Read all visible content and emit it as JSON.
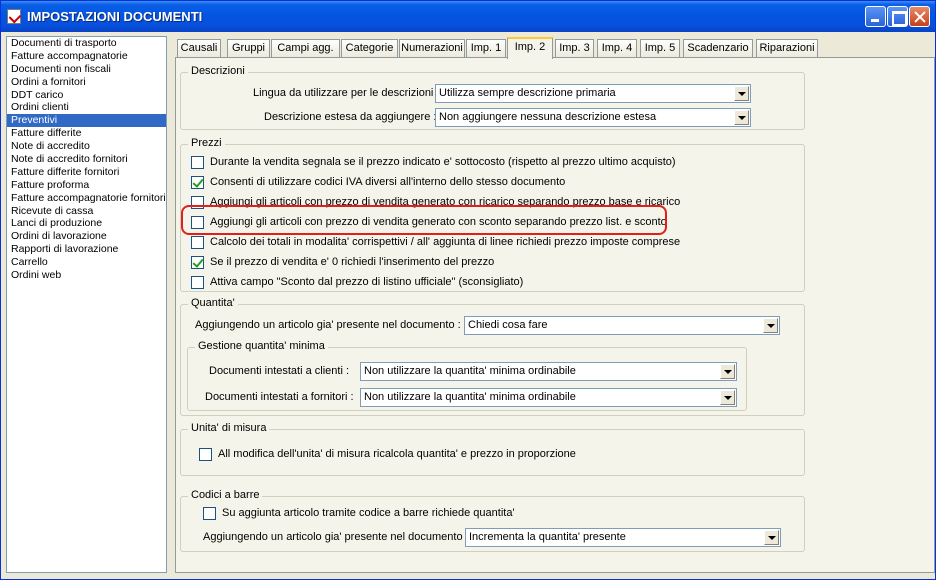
{
  "window": {
    "title": "IMPOSTAZIONI DOCUMENTI"
  },
  "doc_list": [
    "Documenti di trasporto",
    "Fatture accompagnatorie",
    "Documenti non fiscali",
    "Ordini a fornitori",
    "DDT carico",
    "Ordini clienti",
    "Preventivi",
    "Fatture differite",
    "Note di accredito",
    "Note di accredito fornitori",
    "Fatture differite fornitori",
    "Fatture proforma",
    "Fatture accompagnatorie fornitori",
    "Ricevute di cassa",
    "Lanci di produzione",
    "Ordini di lavorazione",
    "Rapporti di lavorazione",
    "Carrello",
    "Ordini web"
  ],
  "selected_doc": "Preventivi",
  "tabs": [
    "Causali",
    "Gruppi",
    "Campi agg.",
    "Categorie",
    "Numerazioni",
    "Imp. 1",
    "Imp. 2",
    "Imp. 3",
    "Imp. 4",
    "Imp. 5",
    "Scadenzario",
    "Riparazioni"
  ],
  "active_tab": "Imp. 2",
  "descrizioni": {
    "title": "Descrizioni",
    "lingua_label": "Lingua da utilizzare per le descrizioni :",
    "lingua_value": "Utilizza sempre descrizione primaria",
    "estesa_label": "Descrizione estesa da aggiungere :",
    "estesa_value": "Non aggiungere nessuna descrizione estesa"
  },
  "prezzi": {
    "title": "Prezzi",
    "items": [
      {
        "label": "Durante la vendita segnala se il prezzo indicato e' sottocosto (rispetto al prezzo ultimo acquisto)",
        "checked": false
      },
      {
        "label": "Consenti di utilizzare codici IVA diversi all'interno dello stesso documento",
        "checked": true
      },
      {
        "label": "Aggiungi gli articoli con prezzo di vendita generato con ricarico separando prezzo base e ricarico",
        "checked": false
      },
      {
        "label": "Aggiungi gli articoli con prezzo di vendita generato con sconto separando prezzo list. e sconto",
        "checked": false
      },
      {
        "label": "Calcolo dei totali in modalita' corrispettivi / all' aggiunta di linee richiedi prezzo imposte comprese",
        "checked": false
      },
      {
        "label": "Se il prezzo di vendita e' 0 richiedi l'inserimento del prezzo",
        "checked": true
      },
      {
        "label": "Attiva campo \"Sconto dal prezzo di listino ufficiale\" (sconsigliato)",
        "checked": false
      }
    ]
  },
  "quantita": {
    "title": "Quantita'",
    "aggiungendo_label": "Aggiungendo un articolo gia' presente nel documento :",
    "aggiungendo_value": "Chiedi cosa fare",
    "minima_title": "Gestione quantita' minima",
    "clienti_label": "Documenti intestati a clienti :",
    "clienti_value": "Non utilizzare la quantita' minima ordinabile",
    "fornitori_label": "Documenti intestati a fornitori :",
    "fornitori_value": "Non utilizzare la quantita' minima ordinabile"
  },
  "unita": {
    "title": "Unita' di misura",
    "item": {
      "label": "All modifica dell'unita' di misura ricalcola quantita' e prezzo in proporzione",
      "checked": false
    }
  },
  "barre": {
    "title": "Codici a barre",
    "item": {
      "label": "Su aggiunta articolo tramite codice a barre richiede quantita'",
      "checked": false
    },
    "aggiungendo_label": "Aggiungendo un articolo gia' presente nel documento :",
    "aggiungendo_value": "Incrementa la quantita' presente"
  }
}
